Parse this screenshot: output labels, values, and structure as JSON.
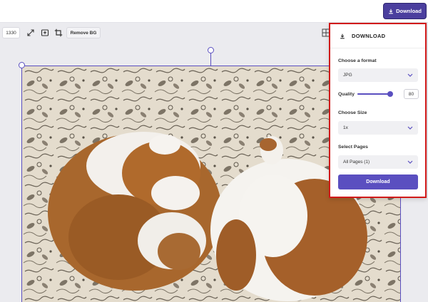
{
  "topbar": {
    "download_label": "Download"
  },
  "toolbar": {
    "zoom_value": "1330",
    "remove_bg_label": "Remove BG"
  },
  "panel": {
    "title": "DOWNLOAD",
    "format_label": "Choose a format",
    "format_value": "JPG",
    "quality_label": "Quality",
    "quality_value": "80",
    "size_label": "Choose Size",
    "size_value": "1x",
    "pages_label": "Select Pages",
    "pages_value": "All Pages (1)",
    "download_button": "Download"
  },
  "colors": {
    "accent": "#5a4fc0",
    "highlight_border": "#d11a1a"
  }
}
